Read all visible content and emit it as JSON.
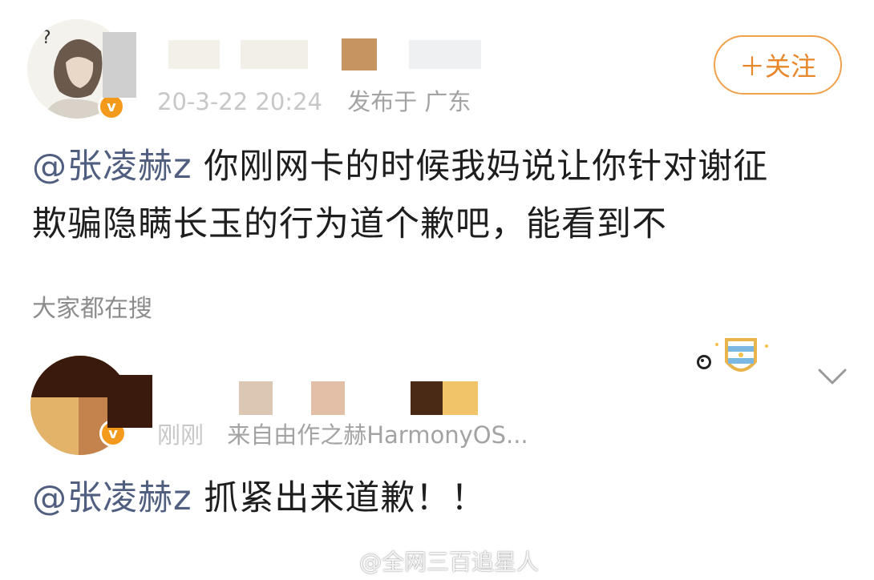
{
  "post1": {
    "follow_label": "＋关注",
    "timestamp": "20-3-22 20:24",
    "location": "发布于 广东",
    "mention": "@张凌赫z",
    "text_line1_rest": " 你刚网卡的时候我妈说让你针对谢征",
    "text_line2": "欺骗隐瞒长玉的行为道个歉吧，能看到不"
  },
  "section_label": "大家都在搜",
  "post2": {
    "meta_time": "刚刚",
    "meta_source": "来自由作之赫HarmonyOS...",
    "mention": "@张凌赫z",
    "text": " 抓紧出来道歉！！"
  },
  "watermark": "@全网三百追星人",
  "colors": {
    "follow_accent": "#e8862a",
    "mention": "#505f80",
    "verified_badge": "#f39a1d"
  }
}
